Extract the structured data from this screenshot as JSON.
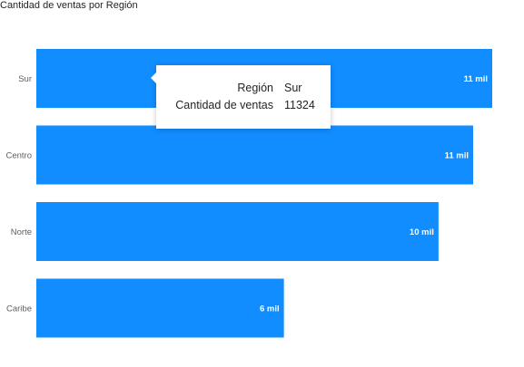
{
  "chart_data": {
    "type": "bar",
    "orientation": "horizontal",
    "title": "Cantidad de ventas por Región",
    "categories": [
      "Sur",
      "Centro",
      "Norte",
      "Caribe"
    ],
    "values": [
      11324,
      10850,
      9990,
      6150
    ],
    "data_labels": [
      "11 mil",
      "11 mil",
      "10 mil",
      "6 mil"
    ],
    "bar_color": "#118DFF",
    "xlim": [
      0,
      11324
    ],
    "grid": false
  },
  "tooltip": {
    "rows": [
      {
        "key": "Región",
        "value": "Sur"
      },
      {
        "key": "Cantidad de ventas",
        "value": "11324"
      }
    ]
  }
}
